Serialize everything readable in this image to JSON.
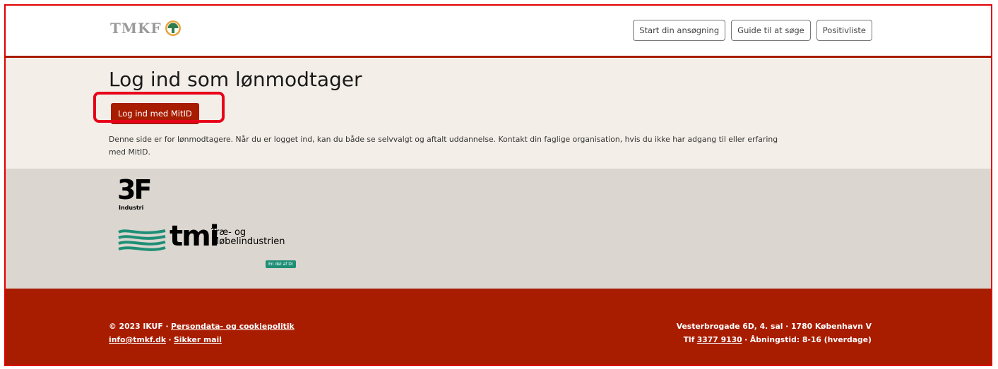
{
  "header": {
    "logo_text": "TMKF",
    "nav": [
      "Start din ansøgning",
      "Guide til at søge",
      "Positivliste"
    ]
  },
  "login": {
    "title": "Log ind som lønmodtager",
    "button_label": "Log ind med MitID",
    "description_1": "Denne side er for lønmodtagere. Når du er logget ind, kan du både se selvvalgt og aftalt uddannelse. Kontakt din faglige organisation, hvis du ikke har adgang til eller erfaring",
    "description_2": "med MitID."
  },
  "partners": {
    "logo_3f": "3F",
    "logo_3f_sub": "Industri",
    "tmi_word": "tmi",
    "tmi_line1": "Træ- og",
    "tmi_line2": "Møbelindustrien",
    "tmi_badge": "En del af DI"
  },
  "footer": {
    "copyright": "© 2023 IKUF ·",
    "privacy_link": "Persondata- og cookiepolitik",
    "email_link": "info@tmkf.dk",
    "separator": "·",
    "secure_mail_link": "Sikker mail",
    "address": "Vesterbrogade 6D, 4. sal · 1780 København V",
    "phone_prefix": "Tlf",
    "phone_link": "3377 9130",
    "hours": "· Åbningstid: 8-16 (hverdage)"
  },
  "colors": {
    "brand_red": "#a81c00",
    "highlight": "#e8001a",
    "section_bg": "#f3efe8",
    "partners_bg": "#dbd6cf"
  }
}
